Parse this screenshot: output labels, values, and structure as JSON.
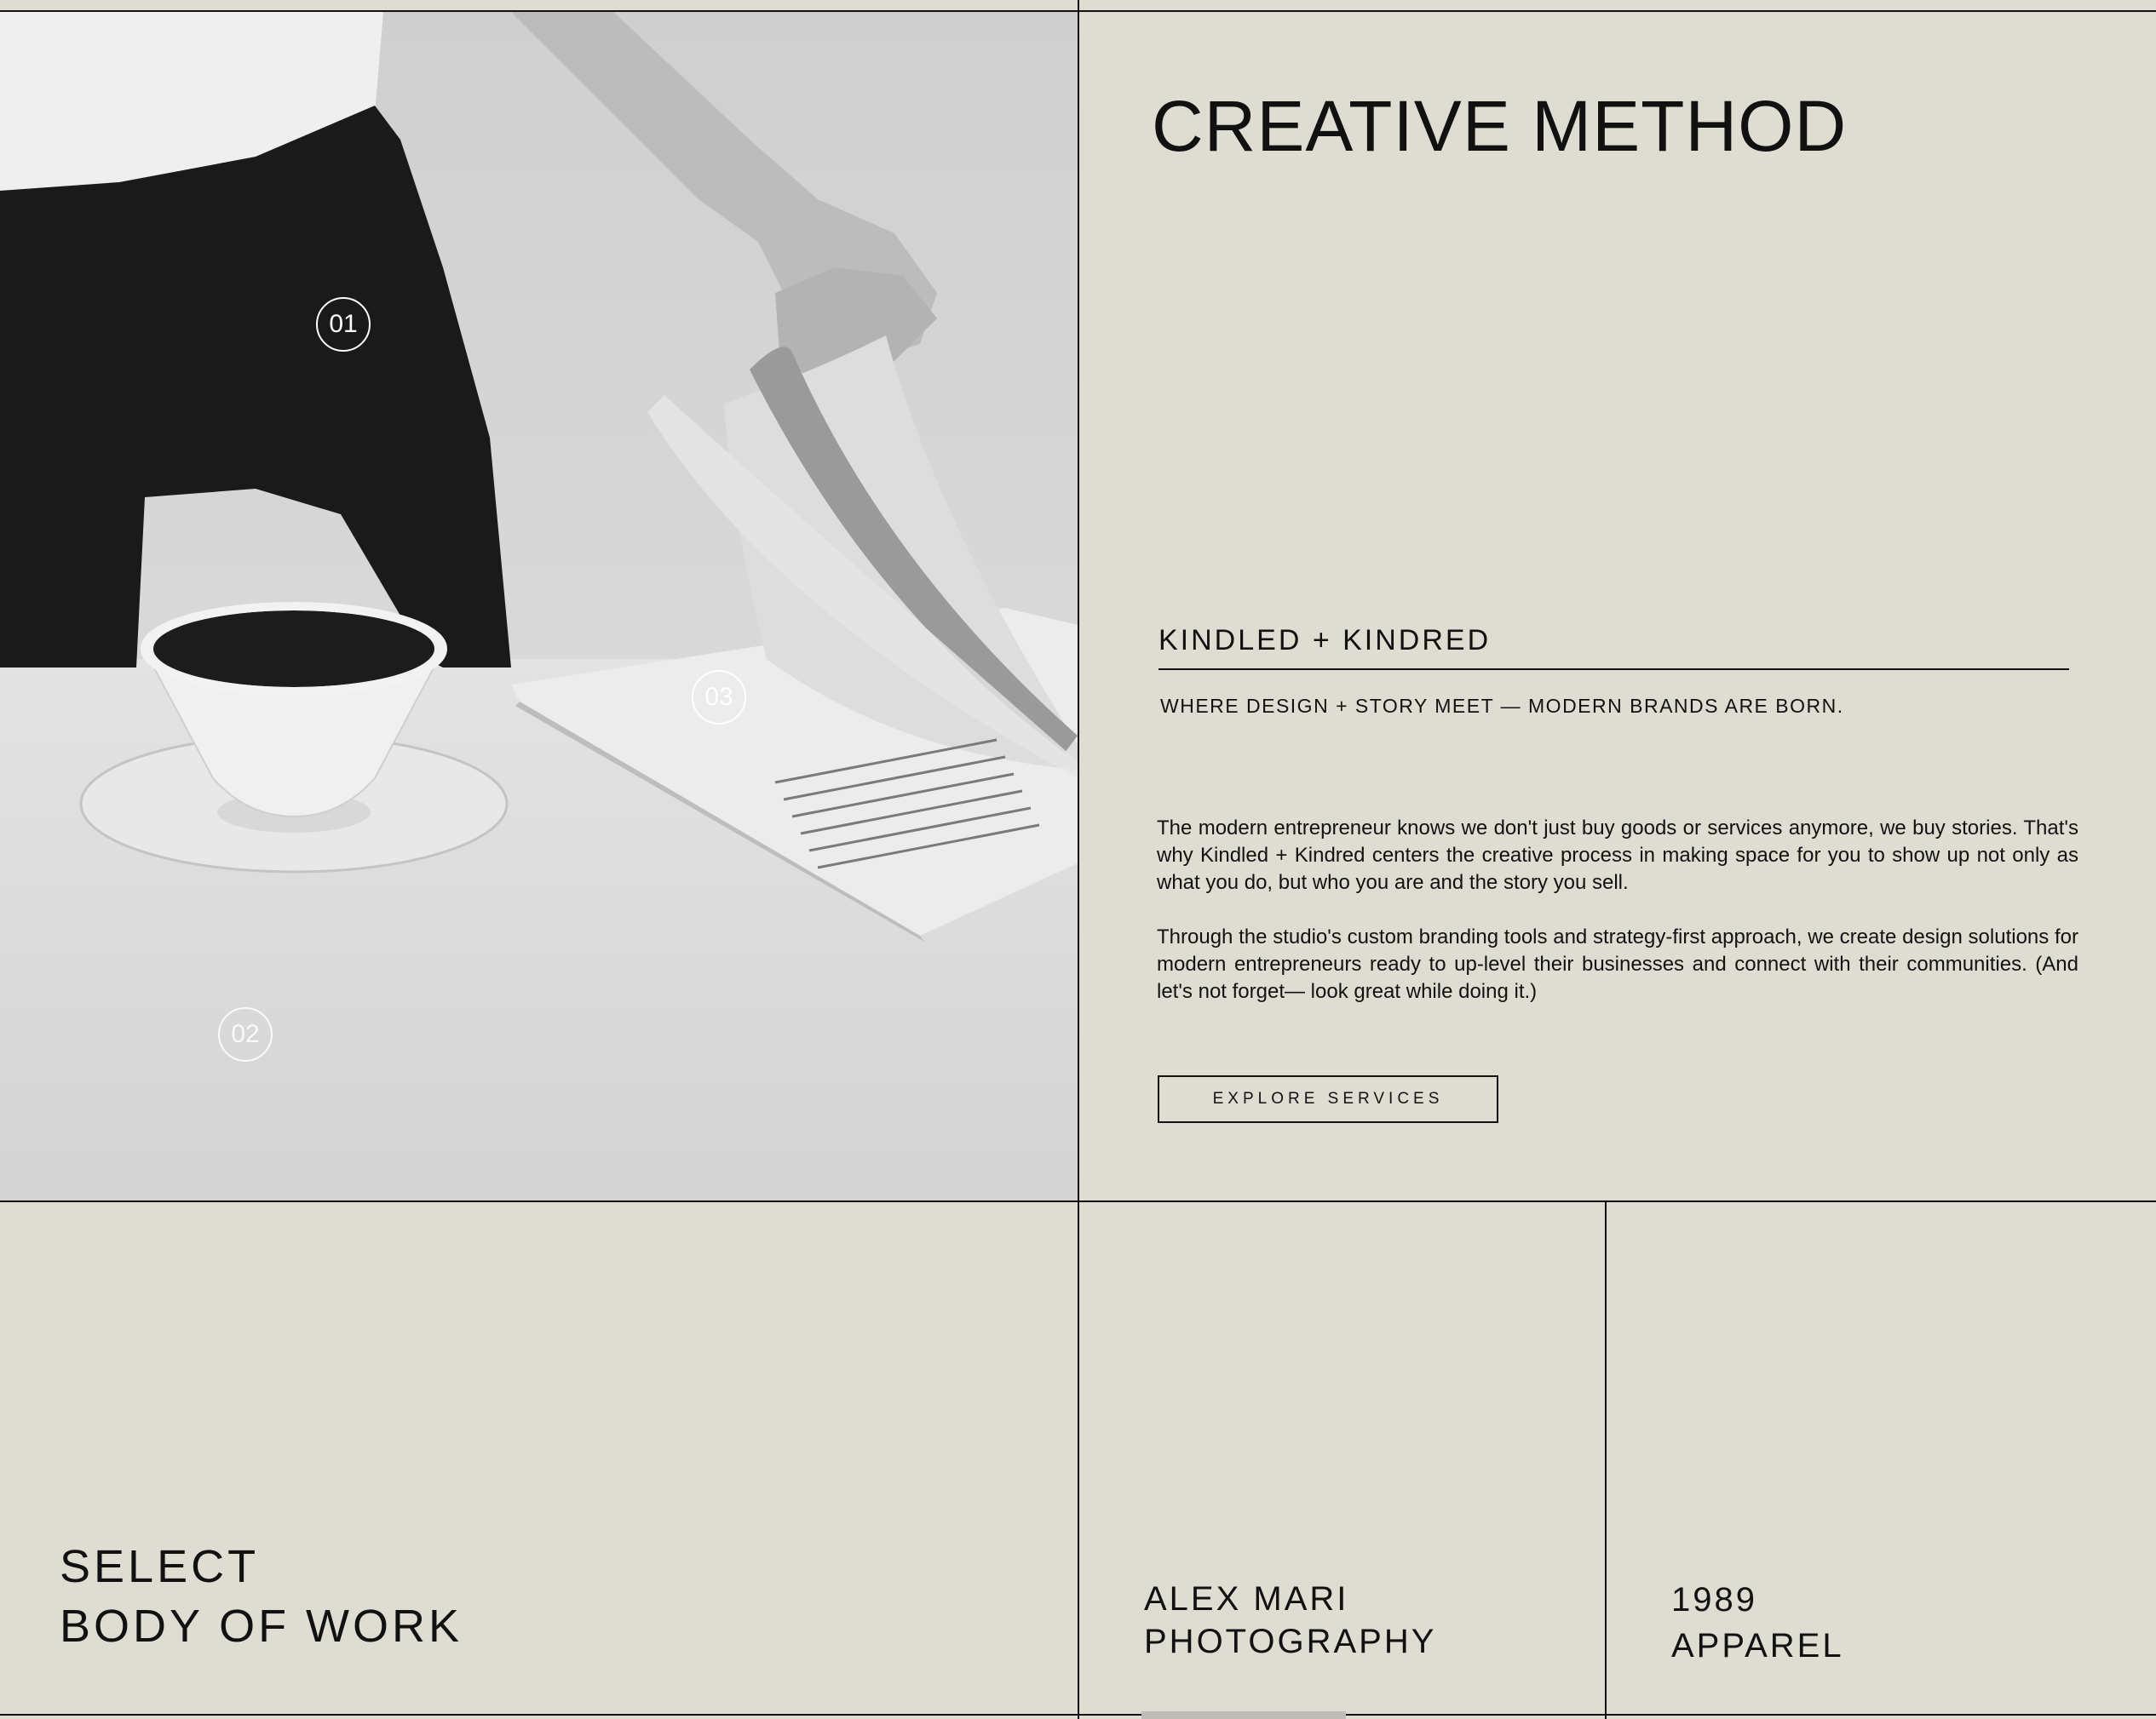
{
  "hero": {
    "hotspots": [
      "01",
      "02",
      "03"
    ]
  },
  "method": {
    "heading": "CREATIVE METHOD",
    "brand": "KINDLED + KINDRED",
    "tagline": "WHERE DESIGN + STORY MEET — MODERN BRANDS ARE BORN.",
    "paragraph1": "The modern entrepreneur knows we don't just buy goods or services anymore, we buy stories. That's why Kindled + Kindred centers the creative process in making space for you to show up not only as what you do, but who you are and the story you sell.",
    "paragraph2": "Through the studio's custom branding tools and strategy-first approach, we create design solutions for modern entrepreneurs ready to up-level their businesses and connect with their communities. (And let's not forget— look great while doing it.)",
    "button_label": "EXPLORE SERVICES"
  },
  "work": {
    "title_line1": "SELECT",
    "title_line2": "BODY OF WORK",
    "items": [
      {
        "line1": "ALEX MARI",
        "line2": "PHOTOGRAPHY"
      },
      {
        "line1": "1989",
        "line2": "APPAREL"
      }
    ]
  },
  "colors": {
    "background": "#dfddd2",
    "ink": "#111111"
  }
}
